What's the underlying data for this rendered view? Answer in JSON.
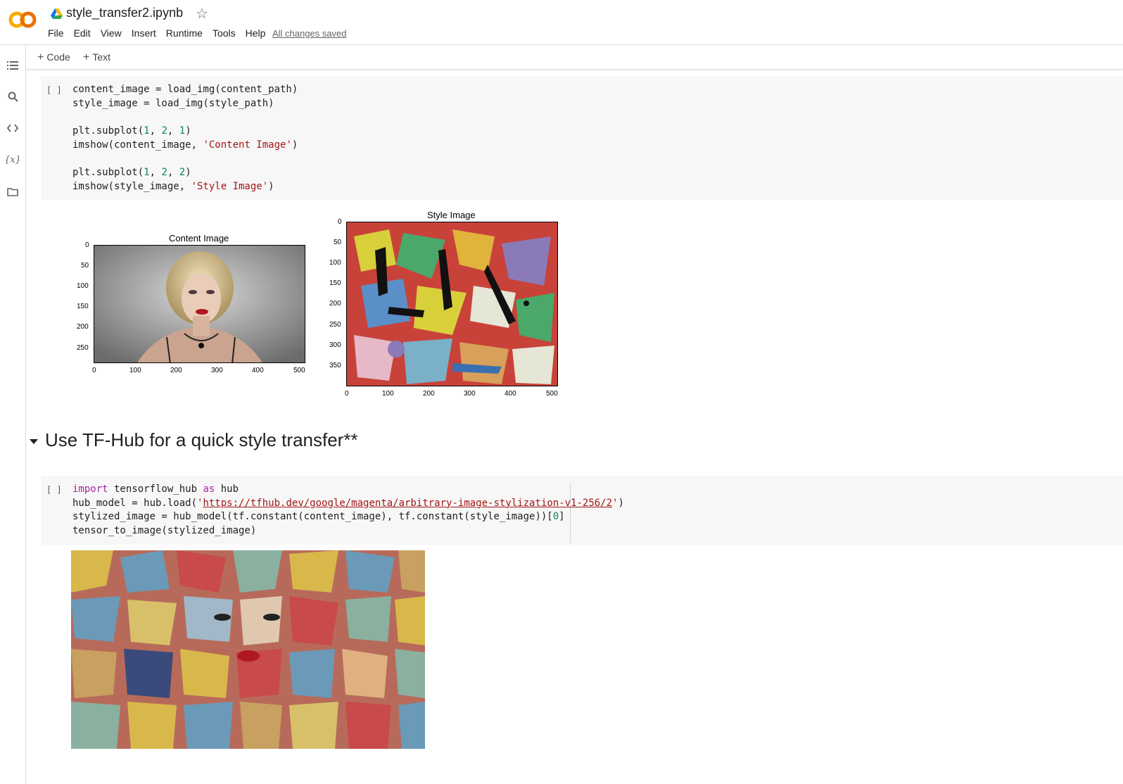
{
  "header": {
    "file_name": "style_transfer2.ipynb",
    "menu": [
      "File",
      "Edit",
      "View",
      "Insert",
      "Runtime",
      "Tools",
      "Help"
    ],
    "save_status": "All changes saved"
  },
  "toolbar": {
    "code_label": "Code",
    "text_label": "Text"
  },
  "cell1": {
    "run": "[ ]",
    "lines": {
      "l1": "content_image = load_img(content_path)",
      "l2": "style_image = load_img(style_path)",
      "l4a": "plt.subplot(",
      "l4b": "1",
      "l4c": ", ",
      "l4d": "2",
      "l4e": ", ",
      "l4f": "1",
      "l4g": ")",
      "l5a": "imshow(content_image, ",
      "l5b": "'Content Image'",
      "l5c": ")",
      "l7a": "plt.subplot(",
      "l7b": "1",
      "l7c": ", ",
      "l7d": "2",
      "l7e": ", ",
      "l7f": "2",
      "l7g": ")",
      "l8a": "imshow(style_image, ",
      "l8b": "'Style Image'",
      "l8c": ")"
    }
  },
  "chart_data": [
    {
      "type": "image",
      "title": "Content Image",
      "xticks": [
        "0",
        "100",
        "200",
        "300",
        "400",
        "500"
      ],
      "yticks": [
        "0",
        "50",
        "100",
        "150",
        "200",
        "250"
      ]
    },
    {
      "type": "image",
      "title": "Style Image",
      "xticks": [
        "0",
        "100",
        "200",
        "300",
        "400",
        "500"
      ],
      "yticks": [
        "0",
        "50",
        "100",
        "150",
        "200",
        "250",
        "300",
        "350"
      ]
    }
  ],
  "section": {
    "heading": "Use TF-Hub for a quick style transfer**"
  },
  "cell2": {
    "run": "[ ]",
    "lines": {
      "l1a": "import",
      "l1b": " tensorflow_hub ",
      "l1c": "as",
      "l1d": " hub",
      "l2a": "hub_model = hub.load(",
      "l2b": "'",
      "l2c": "https://tfhub.dev/google/magenta/arbitrary-image-stylization-v1-256/2",
      "l2d": "'",
      "l2e": ")",
      "l3a": "stylized_image = hub_model(tf.constant(content_image), tf.constant(style_image))[",
      "l3b": "0",
      "l3c": "]",
      "l4": "tensor_to_image(stylized_image)"
    }
  },
  "colors": {
    "keyword": "#a626a4",
    "number": "#098658",
    "string": "#a31515",
    "cell_bg": "#f7f7f7"
  }
}
